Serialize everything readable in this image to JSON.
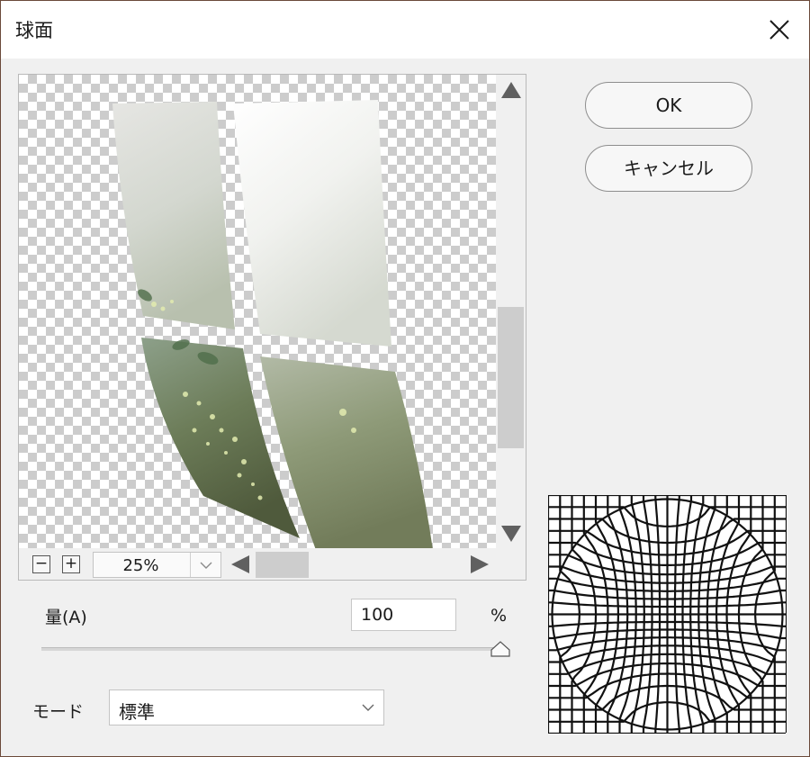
{
  "dialog": {
    "title": "球面",
    "close_icon": "close-icon"
  },
  "preview": {
    "zoom_out_label": "−",
    "zoom_in_label": "+",
    "zoom_value": "25%"
  },
  "buttons": {
    "ok_label": "OK",
    "cancel_label": "キャンセル"
  },
  "amount": {
    "label": "量(A)",
    "value": "100",
    "unit": "%",
    "slider_fraction": 1.0
  },
  "mode": {
    "label": "モード",
    "selected": "標準"
  },
  "colors": {
    "dialog_bg": "#f0f0f0",
    "title_bg": "#ffffff",
    "scrollbar_thumb": "#cdcdcd",
    "foliage_green": "#5d6e4a"
  }
}
